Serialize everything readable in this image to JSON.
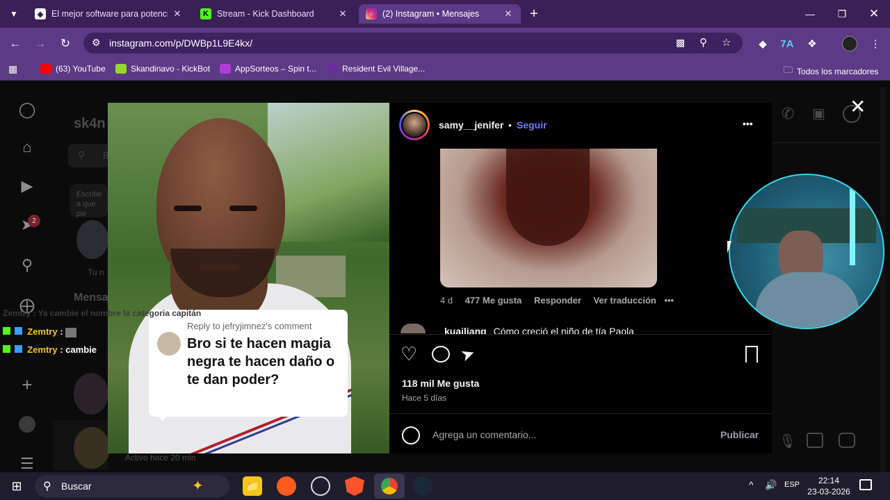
{
  "browser": {
    "tabs": [
      {
        "title": "El mejor software para potencia",
        "favicon": "browser-shield-icon",
        "active": false
      },
      {
        "title": "Stream - Kick Dashboard",
        "favicon": "kick-icon",
        "active": false
      },
      {
        "title": "(2) Instagram • Mensajes",
        "favicon": "instagram-icon",
        "active": true
      }
    ],
    "new_tab_symbol": "+",
    "url": "instagram.com/p/DWBp1L9E4kx/",
    "bookmarks": [
      {
        "label": "(63) YouTube",
        "icon": "youtube-icon"
      },
      {
        "label": "Skandinavo - KickBot",
        "icon": "kickbot-icon"
      },
      {
        "label": "AppSorteos – Spin t...",
        "icon": "appsorteos-icon"
      },
      {
        "label": "Resident Evil Village...",
        "icon": "resident-evil-icon"
      }
    ],
    "all_bookmarks": "Todos los marcadores"
  },
  "instagram_bg": {
    "username": "sk4n",
    "search_placeholder": "B",
    "note_text": "Escribe a que pie",
    "your_note": "Tu n",
    "messages_title": "Mensa",
    "notification_count": "2",
    "active_status": "Activo hace 20 min"
  },
  "stream_overlay": {
    "ghost_chat": "Zemtry : Ya cambie el nombre la categoria capitán",
    "chat": [
      {
        "user": "Zemtry",
        "message": ""
      },
      {
        "user": "Zemtry",
        "message": "cambie"
      }
    ]
  },
  "post": {
    "author": "samy__jenifer",
    "follow": "Seguir",
    "more": "•••",
    "comment": {
      "age": "4 d",
      "likes": "477 Me gusta",
      "reply": "Responder",
      "translate": "Ver traducción",
      "more": "•••"
    },
    "next_comment_user": "kuailiang",
    "next_comment_text": "Cómo creció el niño de tía Paola",
    "likes": "118 mil Me gusta",
    "posted": "Hace 5 días",
    "comment_placeholder": "Agrega un comentario...",
    "publish": "Publicar",
    "video_reply_heading": "Reply to jefryjimnez's comment",
    "video_reply_text": "Bro si te hacen magia negra te hacen daño o te dan poder?"
  },
  "taskbar": {
    "search_label": "Buscar",
    "language": "ESP",
    "time": "22:14",
    "date": "23-03-2026"
  },
  "colors": {
    "tab_bar": "#3b1f57",
    "toolbar": "#5c3a86",
    "link_blue": "#0095f6",
    "chat_user": "#f5c518",
    "kick_green": "#53fc18"
  }
}
